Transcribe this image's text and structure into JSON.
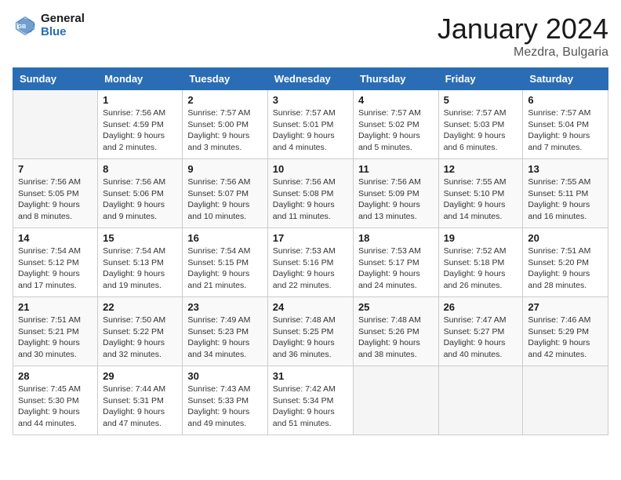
{
  "header": {
    "logo_line1": "General",
    "logo_line2": "Blue",
    "title": "January 2024",
    "subtitle": "Mezdra, Bulgaria"
  },
  "columns": [
    "Sunday",
    "Monday",
    "Tuesday",
    "Wednesday",
    "Thursday",
    "Friday",
    "Saturday"
  ],
  "weeks": [
    [
      {
        "day": "",
        "sunrise": "",
        "sunset": "",
        "daylight": ""
      },
      {
        "day": "1",
        "sunrise": "Sunrise: 7:56 AM",
        "sunset": "Sunset: 4:59 PM",
        "daylight": "Daylight: 9 hours and 2 minutes."
      },
      {
        "day": "2",
        "sunrise": "Sunrise: 7:57 AM",
        "sunset": "Sunset: 5:00 PM",
        "daylight": "Daylight: 9 hours and 3 minutes."
      },
      {
        "day": "3",
        "sunrise": "Sunrise: 7:57 AM",
        "sunset": "Sunset: 5:01 PM",
        "daylight": "Daylight: 9 hours and 4 minutes."
      },
      {
        "day": "4",
        "sunrise": "Sunrise: 7:57 AM",
        "sunset": "Sunset: 5:02 PM",
        "daylight": "Daylight: 9 hours and 5 minutes."
      },
      {
        "day": "5",
        "sunrise": "Sunrise: 7:57 AM",
        "sunset": "Sunset: 5:03 PM",
        "daylight": "Daylight: 9 hours and 6 minutes."
      },
      {
        "day": "6",
        "sunrise": "Sunrise: 7:57 AM",
        "sunset": "Sunset: 5:04 PM",
        "daylight": "Daylight: 9 hours and 7 minutes."
      }
    ],
    [
      {
        "day": "7",
        "sunrise": "Sunrise: 7:56 AM",
        "sunset": "Sunset: 5:05 PM",
        "daylight": "Daylight: 9 hours and 8 minutes."
      },
      {
        "day": "8",
        "sunrise": "Sunrise: 7:56 AM",
        "sunset": "Sunset: 5:06 PM",
        "daylight": "Daylight: 9 hours and 9 minutes."
      },
      {
        "day": "9",
        "sunrise": "Sunrise: 7:56 AM",
        "sunset": "Sunset: 5:07 PM",
        "daylight": "Daylight: 9 hours and 10 minutes."
      },
      {
        "day": "10",
        "sunrise": "Sunrise: 7:56 AM",
        "sunset": "Sunset: 5:08 PM",
        "daylight": "Daylight: 9 hours and 11 minutes."
      },
      {
        "day": "11",
        "sunrise": "Sunrise: 7:56 AM",
        "sunset": "Sunset: 5:09 PM",
        "daylight": "Daylight: 9 hours and 13 minutes."
      },
      {
        "day": "12",
        "sunrise": "Sunrise: 7:55 AM",
        "sunset": "Sunset: 5:10 PM",
        "daylight": "Daylight: 9 hours and 14 minutes."
      },
      {
        "day": "13",
        "sunrise": "Sunrise: 7:55 AM",
        "sunset": "Sunset: 5:11 PM",
        "daylight": "Daylight: 9 hours and 16 minutes."
      }
    ],
    [
      {
        "day": "14",
        "sunrise": "Sunrise: 7:54 AM",
        "sunset": "Sunset: 5:12 PM",
        "daylight": "Daylight: 9 hours and 17 minutes."
      },
      {
        "day": "15",
        "sunrise": "Sunrise: 7:54 AM",
        "sunset": "Sunset: 5:13 PM",
        "daylight": "Daylight: 9 hours and 19 minutes."
      },
      {
        "day": "16",
        "sunrise": "Sunrise: 7:54 AM",
        "sunset": "Sunset: 5:15 PM",
        "daylight": "Daylight: 9 hours and 21 minutes."
      },
      {
        "day": "17",
        "sunrise": "Sunrise: 7:53 AM",
        "sunset": "Sunset: 5:16 PM",
        "daylight": "Daylight: 9 hours and 22 minutes."
      },
      {
        "day": "18",
        "sunrise": "Sunrise: 7:53 AM",
        "sunset": "Sunset: 5:17 PM",
        "daylight": "Daylight: 9 hours and 24 minutes."
      },
      {
        "day": "19",
        "sunrise": "Sunrise: 7:52 AM",
        "sunset": "Sunset: 5:18 PM",
        "daylight": "Daylight: 9 hours and 26 minutes."
      },
      {
        "day": "20",
        "sunrise": "Sunrise: 7:51 AM",
        "sunset": "Sunset: 5:20 PM",
        "daylight": "Daylight: 9 hours and 28 minutes."
      }
    ],
    [
      {
        "day": "21",
        "sunrise": "Sunrise: 7:51 AM",
        "sunset": "Sunset: 5:21 PM",
        "daylight": "Daylight: 9 hours and 30 minutes."
      },
      {
        "day": "22",
        "sunrise": "Sunrise: 7:50 AM",
        "sunset": "Sunset: 5:22 PM",
        "daylight": "Daylight: 9 hours and 32 minutes."
      },
      {
        "day": "23",
        "sunrise": "Sunrise: 7:49 AM",
        "sunset": "Sunset: 5:23 PM",
        "daylight": "Daylight: 9 hours and 34 minutes."
      },
      {
        "day": "24",
        "sunrise": "Sunrise: 7:48 AM",
        "sunset": "Sunset: 5:25 PM",
        "daylight": "Daylight: 9 hours and 36 minutes."
      },
      {
        "day": "25",
        "sunrise": "Sunrise: 7:48 AM",
        "sunset": "Sunset: 5:26 PM",
        "daylight": "Daylight: 9 hours and 38 minutes."
      },
      {
        "day": "26",
        "sunrise": "Sunrise: 7:47 AM",
        "sunset": "Sunset: 5:27 PM",
        "daylight": "Daylight: 9 hours and 40 minutes."
      },
      {
        "day": "27",
        "sunrise": "Sunrise: 7:46 AM",
        "sunset": "Sunset: 5:29 PM",
        "daylight": "Daylight: 9 hours and 42 minutes."
      }
    ],
    [
      {
        "day": "28",
        "sunrise": "Sunrise: 7:45 AM",
        "sunset": "Sunset: 5:30 PM",
        "daylight": "Daylight: 9 hours and 44 minutes."
      },
      {
        "day": "29",
        "sunrise": "Sunrise: 7:44 AM",
        "sunset": "Sunset: 5:31 PM",
        "daylight": "Daylight: 9 hours and 47 minutes."
      },
      {
        "day": "30",
        "sunrise": "Sunrise: 7:43 AM",
        "sunset": "Sunset: 5:33 PM",
        "daylight": "Daylight: 9 hours and 49 minutes."
      },
      {
        "day": "31",
        "sunrise": "Sunrise: 7:42 AM",
        "sunset": "Sunset: 5:34 PM",
        "daylight": "Daylight: 9 hours and 51 minutes."
      },
      {
        "day": "",
        "sunrise": "",
        "sunset": "",
        "daylight": ""
      },
      {
        "day": "",
        "sunrise": "",
        "sunset": "",
        "daylight": ""
      },
      {
        "day": "",
        "sunrise": "",
        "sunset": "",
        "daylight": ""
      }
    ]
  ]
}
